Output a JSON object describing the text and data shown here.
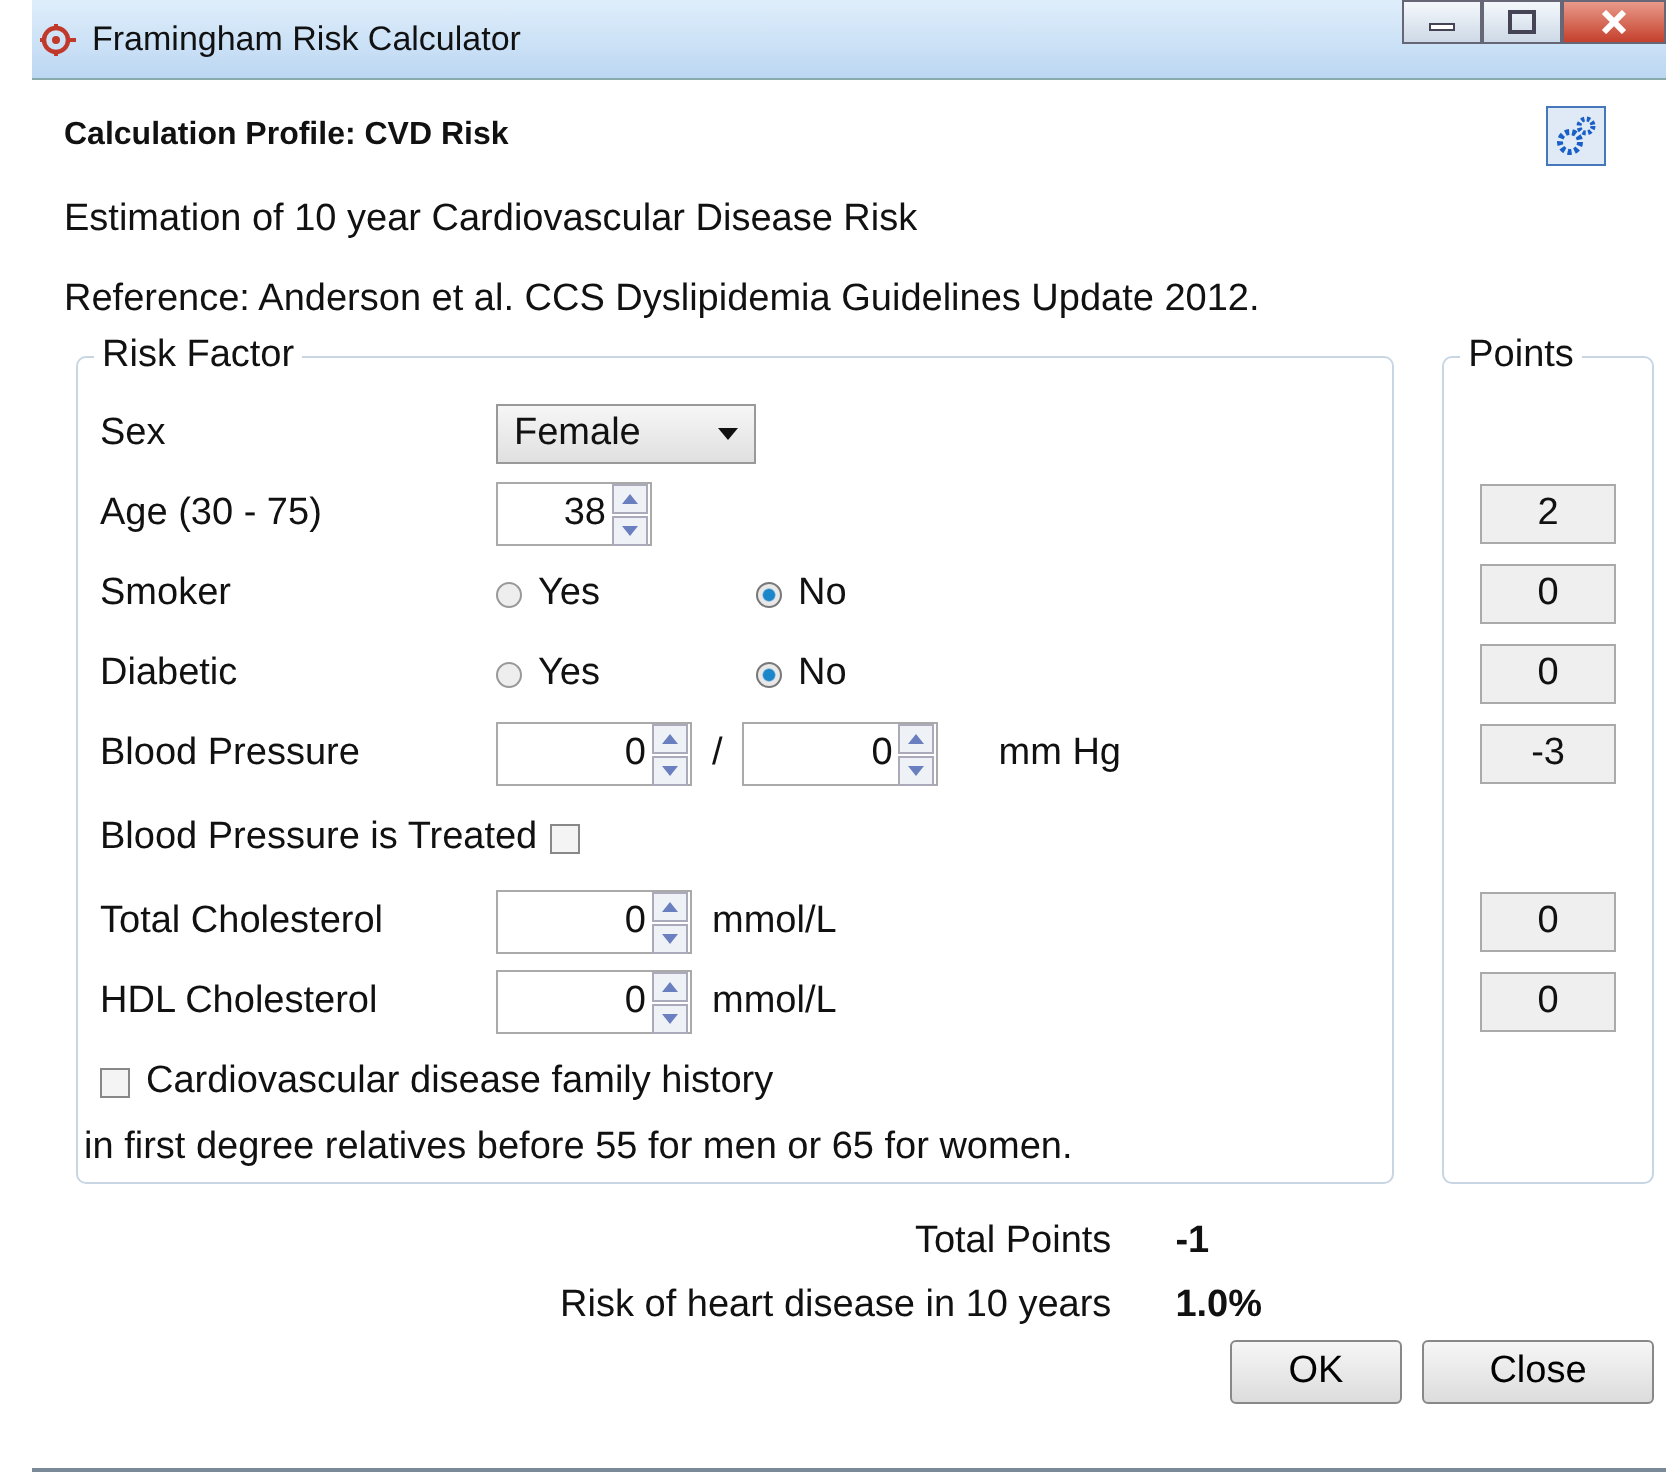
{
  "window": {
    "title": "Framingham Risk Calculator"
  },
  "profile": "Calculation Profile: CVD Risk",
  "description": "Estimation of 10 year Cardiovascular Disease Risk",
  "reference": "Reference:  Anderson et al. CCS Dyslipidemia Guidelines Update 2012.",
  "risk_factor_group": {
    "title": "Risk Factor",
    "factors": [
      {
        "kind": "select",
        "label": "Sex",
        "value": "Female"
      },
      {
        "kind": "spinner",
        "label": "Age (30 - 75)",
        "value": "38",
        "points": "2"
      },
      {
        "kind": "radio",
        "label": "Smoker",
        "options": [
          {
            "label": "Yes",
            "selected": false
          },
          {
            "label": "No",
            "selected": true
          }
        ],
        "points": "0"
      },
      {
        "kind": "radio",
        "label": "Diabetic",
        "options": [
          {
            "label": "Yes",
            "selected": false
          },
          {
            "label": "No",
            "selected": true
          }
        ],
        "points": "0"
      },
      {
        "kind": "pressure",
        "label": "Blood Pressure",
        "values": [
          "0",
          "0"
        ],
        "separator": "/",
        "unit": "mm Hg",
        "points": "-3"
      },
      {
        "kind": "checkbox",
        "label": "Blood Pressure is Treated",
        "checked": false
      },
      {
        "kind": "spinner",
        "label": "Total Cholesterol",
        "value": "0",
        "unit": "mmol/L",
        "points": "0"
      },
      {
        "kind": "spinner",
        "label": "HDL Cholesterol",
        "value": "0",
        "unit": "mmol/L",
        "points": "0"
      }
    ],
    "family_history": {
      "label": "Cardiovascular disease family history",
      "note": "in first degree relatives before 55 for men or 65 for women.",
      "checked": false
    }
  },
  "points_group": {
    "title": "Points"
  },
  "results": [
    {
      "label": "Total Points",
      "value": "-1"
    },
    {
      "label": "Risk of heart disease in 10 years",
      "value": "1.0%"
    }
  ],
  "buttons": [
    "OK",
    "Close"
  ]
}
